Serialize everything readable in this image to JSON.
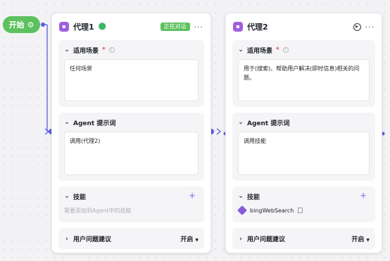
{
  "start": {
    "label": "开始",
    "icon": "gear-icon",
    "color": "#5cc15e"
  },
  "accent": "#5b5ce6",
  "agents": [
    {
      "title": "代理1",
      "badge": "正在对话",
      "sections": {
        "scene": {
          "label": "适用场景",
          "required": "*",
          "value": "任何场景"
        },
        "prompt": {
          "label": "Agent 提示词",
          "value": "调用(代理2)"
        },
        "skills": {
          "label": "技能",
          "hint": "需要添加到Agent中的技能"
        },
        "suggest": {
          "label": "用户问题建议",
          "value": "开启"
        }
      }
    },
    {
      "title": "代理2",
      "sections": {
        "scene": {
          "label": "适用场景",
          "required": "*",
          "value": "用于(搜索)、帮助用户解决(即时信息)相关的问题。"
        },
        "prompt": {
          "label": "Agent 提示词",
          "value": "调用技能"
        },
        "skills": {
          "label": "技能",
          "item": "bingWebSearch"
        },
        "suggest": {
          "label": "用户问题建议",
          "value": "开启"
        }
      }
    }
  ]
}
